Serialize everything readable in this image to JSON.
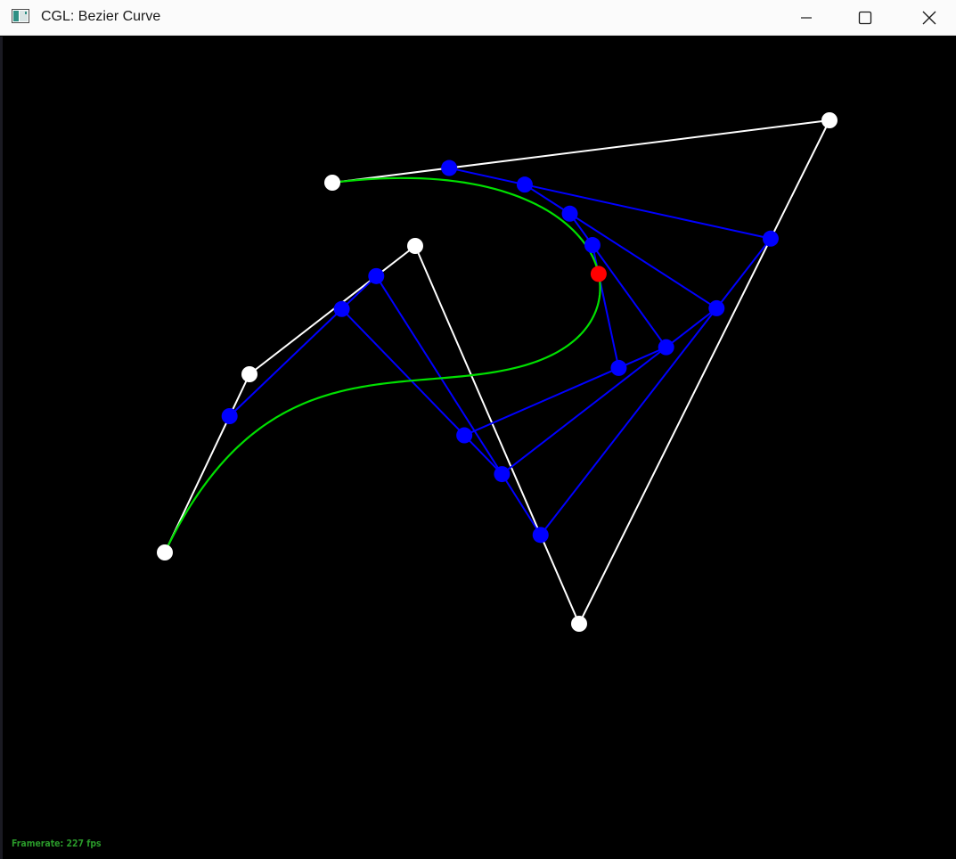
{
  "window": {
    "title": "CGL: Bezier Curve",
    "app_icon": "cgl-app-icon",
    "controls": {
      "minimize_icon": "minimize-icon",
      "maximize_icon": "maximize-icon",
      "close_icon": "close-icon"
    }
  },
  "status": {
    "framerate": "Framerate: 227 fps"
  },
  "colors": {
    "background": "#000000",
    "control_polygon": "#ffffff",
    "intermediate": "#0000ff",
    "curve": "#00e000",
    "evaluated_point": "#ff0000",
    "framerate_text": "#2a9a2a"
  }
}
